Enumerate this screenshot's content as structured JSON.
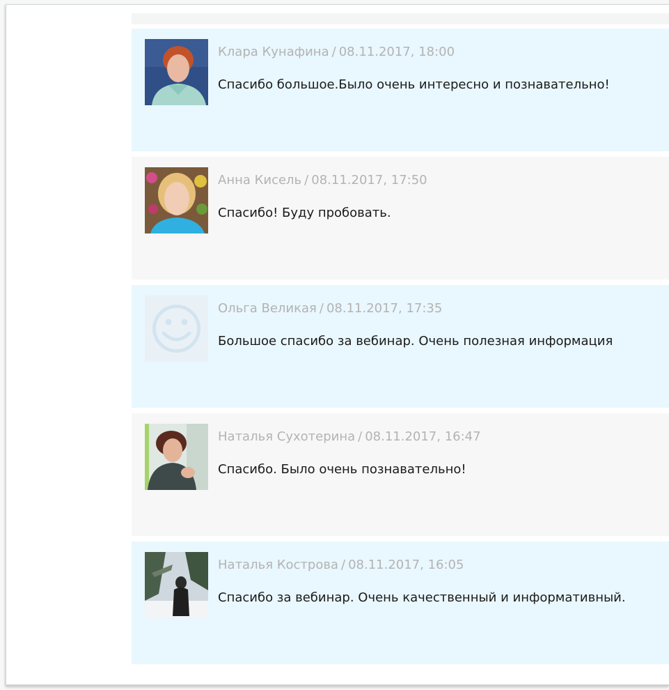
{
  "comments": [
    {
      "author": "Клара Кунафина",
      "date": "08.11.2017, 18:00",
      "text": "Спасибо большое.Было очень интересно и познавательно!",
      "avatar_icon": "user-photo-icon"
    },
    {
      "author": "Анна Кисель",
      "date": "08.11.2017, 17:50",
      "text": "Спасибо! Буду пробовать.",
      "avatar_icon": "user-photo-icon"
    },
    {
      "author": "Ольга Великая",
      "date": "08.11.2017, 17:35",
      "text": "Большое спасибо за вебинар. Очень полезная информация",
      "avatar_icon": "smiley-placeholder-icon"
    },
    {
      "author": "Наталья Сухотерина",
      "date": "08.11.2017, 16:47",
      "text": "Спасибо. Было очень познавательно!",
      "avatar_icon": "user-photo-icon"
    },
    {
      "author": "Наталья Кострова",
      "date": "08.11.2017, 16:05",
      "text": "Спасибо за вебинар. Очень качественный и информативный.",
      "avatar_icon": "user-photo-icon"
    }
  ],
  "separator": "/",
  "colors": {
    "row_blue": "#e9f7fe",
    "row_gray": "#f7f7f7",
    "meta_text": "#b3b3b3",
    "body_text": "#1a1a1a"
  }
}
